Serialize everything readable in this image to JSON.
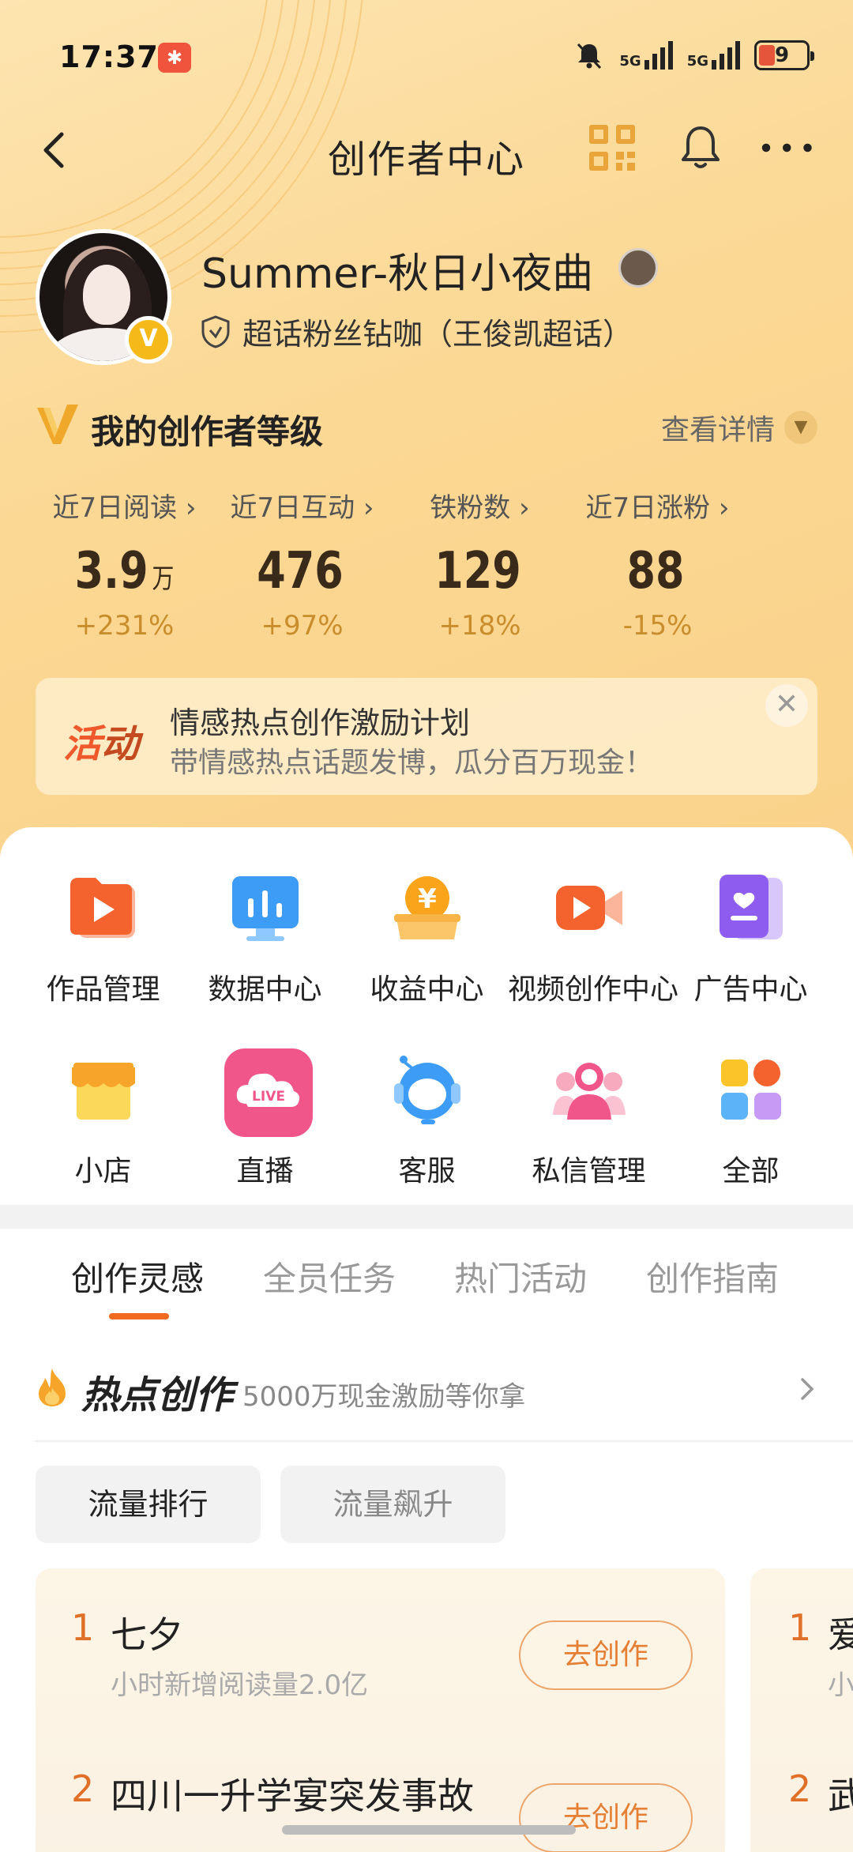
{
  "status_bar": {
    "time": "17:37",
    "battery": "9",
    "signal_1": "5G",
    "signal_2": "5G"
  },
  "header": {
    "title": "创作者中心"
  },
  "profile": {
    "username": "Summer-秋日小夜曲",
    "verified_badge": "V",
    "supertag": "超话粉丝钻咖（王俊凯超话）"
  },
  "level": {
    "title": "我的创作者等级",
    "detail_label": "查看详情"
  },
  "stats": [
    {
      "label": "近7日阅读",
      "value": "3.9",
      "unit": "万",
      "change": "+231%"
    },
    {
      "label": "近7日互动",
      "value": "476",
      "unit": "",
      "change": "+97%"
    },
    {
      "label": "铁粉数",
      "value": "129",
      "unit": "",
      "change": "+18%"
    },
    {
      "label": "近7日涨粉",
      "value": "88",
      "unit": "",
      "change": "-15%"
    }
  ],
  "activity": {
    "tag_1": "活",
    "tag_2": "动",
    "title": "情感热点创作激励计划",
    "subtitle": "带情感热点话题发博，瓜分百万现金！"
  },
  "tools_row_1": [
    {
      "label": "作品管理",
      "icon": "works-icon"
    },
    {
      "label": "数据中心",
      "icon": "data-icon"
    },
    {
      "label": "收益中心",
      "icon": "income-icon"
    },
    {
      "label": "视频创作中心",
      "icon": "video-icon"
    },
    {
      "label": "广告中心",
      "icon": "ad-icon"
    }
  ],
  "tools_row_2": [
    {
      "label": "小店",
      "icon": "shop-icon"
    },
    {
      "label": "直播",
      "icon": "live-icon"
    },
    {
      "label": "客服",
      "icon": "service-icon"
    },
    {
      "label": "私信管理",
      "icon": "message-icon"
    },
    {
      "label": "全部",
      "icon": "all-icon"
    }
  ],
  "live_icon_text": "LIVE",
  "income_icon_text": "¥",
  "tabs": [
    "创作灵感",
    "全员任务",
    "热门活动",
    "创作指南"
  ],
  "hot": {
    "title": "热点创作",
    "subtitle": "5000万现金激励等你拿"
  },
  "chips": [
    "流量排行",
    "流量飙升"
  ],
  "ranking_1": [
    {
      "rank": "1",
      "title": "七夕",
      "desc": "小时新增阅读量2.0亿",
      "button": "去创作"
    },
    {
      "rank": "2",
      "title": "四川一升学宴突发事故",
      "desc": "",
      "button": "去创作"
    }
  ],
  "ranking_2": [
    {
      "rank": "1",
      "title": "爱",
      "desc": "小"
    },
    {
      "rank": "2",
      "title": "武",
      "desc": ""
    }
  ],
  "colors": {
    "accent": "#f26a20",
    "header_bg": "#fbd894",
    "stat_change": "#c98d2b"
  }
}
